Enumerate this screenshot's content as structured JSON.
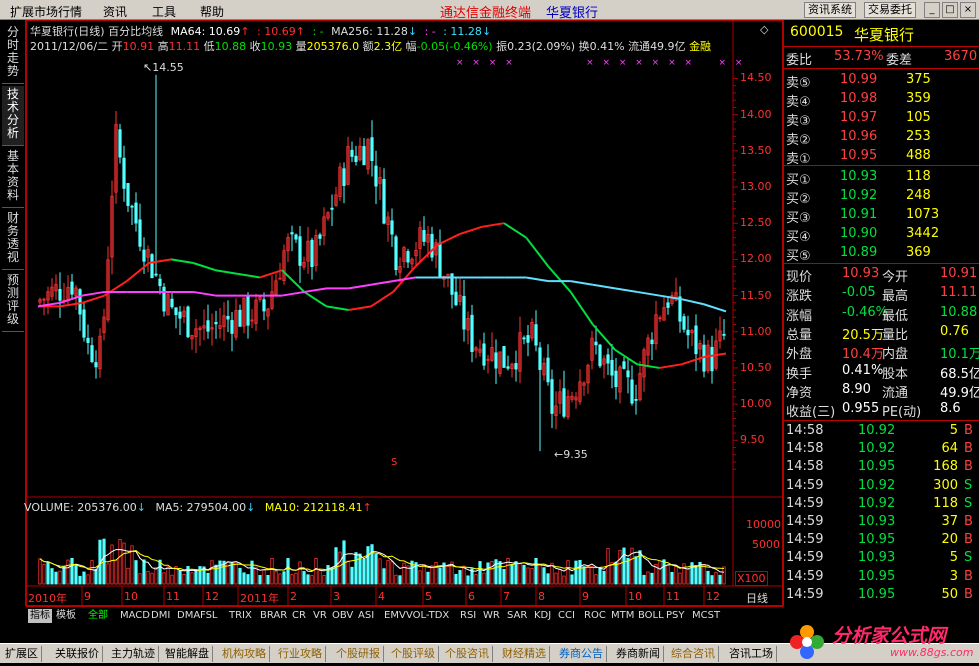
{
  "menu": {
    "items": [
      "扩展市场行情",
      "资讯",
      "工具",
      "帮助"
    ],
    "brand": "通达信金融终端",
    "stock_name": "华夏银行",
    "btn_news": "资讯系统",
    "btn_trade": "交易委托",
    "win_min": "_",
    "win_max": "□",
    "win_close": "×"
  },
  "left_tabs": [
    "分时走势",
    "技术分析",
    "基本资料",
    "财务透视",
    "预测评级"
  ],
  "chart": {
    "header1": {
      "title": "华夏银行(日线) 百分比均线",
      "ma64": "MA64: 10.69",
      "ma64_arrow": "↑",
      "ma_b": ": 10.69",
      "ma_b_arrow": "↑",
      "ma_c": ": -",
      "ma256": "MA256: 11.28",
      "ma256_arrow": "↓",
      "ma_d": ": -",
      "ma_e": ": 11.28",
      "ma_e_arrow": "↓"
    },
    "header2": {
      "date": "2011/12/06/二",
      "open_l": "开",
      "open": "10.91",
      "high_l": "高",
      "high": "11.11",
      "low_l": "低",
      "low": "10.88",
      "close_l": "收",
      "close": "10.93",
      "vol_l": "量",
      "vol": "205376.0",
      "amt_l": "额",
      "amt": "2.3亿",
      "chg_l": "幅",
      "chg": "-0.05(-0.46%)",
      "amp_l": "振",
      "amp": "0.23(2.09%)",
      "turn_l": "换",
      "turn": "0.41%",
      "float_l": "流通",
      "float": "49.9亿",
      "extra": "金融"
    },
    "high_label": "14.55",
    "low_label": "9.35",
    "price_ticks": [
      "14.50",
      "14.00",
      "13.50",
      "13.00",
      "12.50",
      "12.00",
      "11.50",
      "11.00",
      "10.50",
      "10.00",
      "9.50"
    ],
    "vol_header": {
      "vol": "VOLUME: 205376.00",
      "vol_arrow": "↓",
      "ma5": "MA5: 279504.00",
      "ma5_arrow": "↓",
      "ma10": "MA10: 212118.41",
      "ma10_arrow": "↑"
    },
    "vol_ticks": [
      "10000",
      "5000"
    ],
    "vol_unit": "X100",
    "period_label": "日线",
    "x_labels": [
      "2010年",
      "9",
      "10",
      "11",
      "12",
      "2011年",
      "2",
      "3",
      "4",
      "5",
      "6",
      "7",
      "8",
      "9",
      "10",
      "11",
      "12"
    ],
    "s_marker": "S"
  },
  "chart_data": {
    "type": "candlestick",
    "title": "华夏银行(日线) 百分比均线",
    "x_range": [
      "2010-08",
      "2011-12-06"
    ],
    "ylim": [
      9.2,
      14.7
    ],
    "series": [
      {
        "name": "MA64",
        "values": [
          11.35,
          11.35,
          11.4,
          11.5,
          11.7,
          11.95,
          12.0,
          11.95,
          11.85,
          11.8,
          11.75,
          11.85,
          11.55,
          11.35,
          11.3,
          11.35,
          11.55,
          11.9,
          12.2,
          12.35,
          12.45,
          12.5,
          12.3,
          11.9,
          11.55,
          11.1,
          10.75,
          10.55,
          10.5,
          10.55,
          10.65,
          10.7
        ]
      },
      {
        "name": "MA256",
        "values": [
          11.35,
          11.4,
          11.5,
          11.55,
          11.55,
          11.55,
          11.55,
          11.55,
          11.5,
          11.5,
          11.5,
          11.5,
          11.55,
          11.6,
          11.6,
          11.65,
          11.7,
          11.75,
          11.75,
          11.75,
          11.75,
          11.75,
          11.75,
          11.7,
          11.7,
          11.65,
          11.6,
          11.55,
          11.5,
          11.45,
          11.38,
          11.28
        ]
      }
    ],
    "high": 14.55,
    "low": 9.35,
    "last": {
      "open": 10.91,
      "high": 11.11,
      "low": 10.88,
      "close": 10.93,
      "volume": 205376.0
    },
    "volume": {
      "ma5": 279504.0,
      "ma10": 212118.41,
      "ylim": [
        0,
        13000
      ]
    }
  },
  "quote": {
    "code": "600015",
    "name": "华夏银行",
    "wb_l": "委比",
    "wb": "53.73%",
    "wc_l": "委差",
    "wc": "3670",
    "asks": [
      {
        "l": "卖⑤",
        "p": "10.99",
        "v": "375"
      },
      {
        "l": "卖④",
        "p": "10.98",
        "v": "359"
      },
      {
        "l": "卖③",
        "p": "10.97",
        "v": "105"
      },
      {
        "l": "卖②",
        "p": "10.96",
        "v": "253"
      },
      {
        "l": "卖①",
        "p": "10.95",
        "v": "488"
      }
    ],
    "bids": [
      {
        "l": "买①",
        "p": "10.93",
        "v": "118"
      },
      {
        "l": "买②",
        "p": "10.92",
        "v": "248"
      },
      {
        "l": "买③",
        "p": "10.91",
        "v": "1073"
      },
      {
        "l": "买④",
        "p": "10.90",
        "v": "3442"
      },
      {
        "l": "买⑤",
        "p": "10.89",
        "v": "369"
      }
    ],
    "stats": [
      {
        "l1": "现价",
        "v1": "10.93",
        "c1": "#ff4040",
        "l2": "今开",
        "v2": "10.91",
        "c2": "#ff4040"
      },
      {
        "l1": "涨跌",
        "v1": "-0.05",
        "c1": "#00e040",
        "l2": "最高",
        "v2": "11.11",
        "c2": "#ff4040"
      },
      {
        "l1": "涨幅",
        "v1": "-0.46%",
        "c1": "#00e040",
        "l2": "最低",
        "v2": "10.88",
        "c2": "#00e040"
      },
      {
        "l1": "总量",
        "v1": "20.5万",
        "c1": "#ffff00",
        "l2": "量比",
        "v2": "0.76",
        "c2": "#ffff00"
      },
      {
        "l1": "外盘",
        "v1": "10.4万",
        "c1": "#ff4040",
        "l2": "内盘",
        "v2": "10.1万",
        "c2": "#00e040"
      },
      {
        "l1": "换手",
        "v1": "0.41%",
        "c1": "#ffffff",
        "l2": "股本",
        "v2": "68.5亿",
        "c2": "#ffffff"
      },
      {
        "l1": "净资",
        "v1": "8.90",
        "c1": "#ffffff",
        "l2": "流通",
        "v2": "49.9亿",
        "c2": "#ffffff"
      },
      {
        "l1": "收益(三)",
        "v1": "0.955",
        "c1": "#ffffff",
        "l2": "PE(动)",
        "v2": "8.6",
        "c2": "#ffffff"
      }
    ],
    "ticks": [
      {
        "t": "14:58",
        "p": "10.92",
        "v": "5",
        "s": "B"
      },
      {
        "t": "14:58",
        "p": "10.92",
        "v": "64",
        "s": "B"
      },
      {
        "t": "14:58",
        "p": "10.95",
        "v": "168",
        "s": "B"
      },
      {
        "t": "14:59",
        "p": "10.92",
        "v": "300",
        "s": "S"
      },
      {
        "t": "14:59",
        "p": "10.92",
        "v": "118",
        "s": "S"
      },
      {
        "t": "14:59",
        "p": "10.93",
        "v": "37",
        "s": "B"
      },
      {
        "t": "14:59",
        "p": "10.95",
        "v": "20",
        "s": "B"
      },
      {
        "t": "14:59",
        "p": "10.93",
        "v": "5",
        "s": "S"
      },
      {
        "t": "14:59",
        "p": "10.95",
        "v": "3",
        "s": "B"
      },
      {
        "t": "14:59",
        "p": "10.95",
        "v": "50",
        "s": "B"
      }
    ]
  },
  "indicators": [
    "指标",
    "模板",
    "全部",
    "MACD",
    "DMI",
    "DMA",
    "FSL",
    "TRIX",
    "BRAR",
    "CR",
    "VR",
    "OBV",
    "ASI",
    "EMV",
    "VOL-TDX",
    "RSI",
    "WR",
    "SAR",
    "KDJ",
    "CCI",
    "ROC",
    "MTM",
    "BOLL",
    "PSY",
    "MCST"
  ],
  "bottom_tabs": [
    "扩展区",
    "关联报价",
    "主力轨迹",
    "智能解盘",
    "机构攻略",
    "行业攻略",
    "个股研报",
    "个股评级",
    "个股咨讯",
    "财经精选",
    "券商公告",
    "券商新闻",
    "综合咨讯",
    "咨讯工场"
  ],
  "logo_text": "分析家公式网",
  "logo_url_text": "www.88gs.com"
}
